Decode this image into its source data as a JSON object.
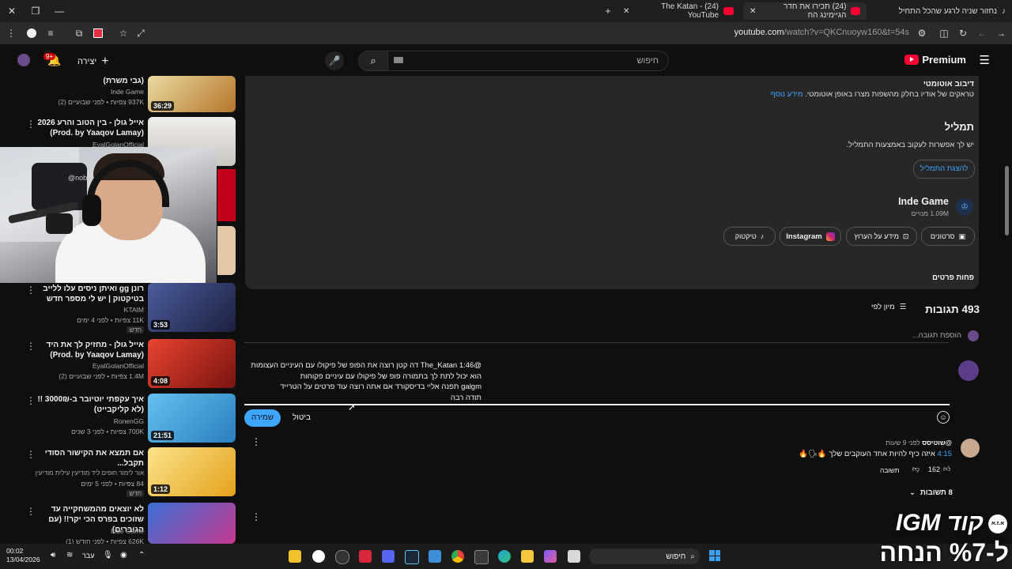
{
  "browser": {
    "tabs": [
      {
        "title": "נחזור שניה לרגע שהכל התחיל",
        "icon": "tiktok-icon",
        "active": false
      },
      {
        "title": "(24) תכירו את חדר הגיימינג הח",
        "icon": "youtube-icon",
        "active": true
      },
      {
        "title": "(24) The Katan - YouTube",
        "icon": "youtube-icon",
        "active": false
      }
    ],
    "url_main": "youtube.com",
    "url_rest": "/watch?v=QKCnuoyw160&t=54s",
    "new_tab": "+"
  },
  "masthead": {
    "search_placeholder": "חיפוש",
    "create_label": "יצירה",
    "notif_count": "9+",
    "premium_label": "Premium"
  },
  "sidebar_videos": [
    {
      "title": "(גבי משרת)",
      "channel": "Inde Game",
      "meta": "937K צפיות • לפני שבועיים (2)",
      "duration": "36:29",
      "thumb_color": "#c79a2e"
    },
    {
      "title": "אייל גולן - בין הטוב והרע 2026 (Prod. by Yaaqov Lamay)",
      "channel": "EyalGolanOfficial",
      "meta": "",
      "duration": "",
      "thumb_color": "#e9e6e1"
    },
    {
      "title": "רונן gg ואיתן ניסים עלו ללייב בטיקטוק | יש לי מספר חדש",
      "channel": "KTAIM",
      "meta": "11K צפיות • לפני 4 ימים",
      "duration": "3:53",
      "badge": "חדש",
      "thumb_color": "#3a3f6e"
    },
    {
      "title": "אייל גולן - מחזיק לך את היד (Prod. by Yaaqov Lamay)",
      "channel": "EyalGolanOfficial",
      "meta": "1.4M צפיות • לפני שבועיים (2)",
      "duration": "4:08",
      "thumb_color": "#d63b2b"
    },
    {
      "title": "איך עקפתי יוטיובר ב-3000₪ !! (לא קליקבייט)",
      "channel": "RonenGG",
      "meta": "700K צפיות • לפני 3 שנים",
      "duration": "21:51",
      "thumb_color": "#3f9fd8"
    },
    {
      "title": "אם תמצא את הקישור הסודי תקבל...",
      "channel": "אור לימור חופים ליד מודיעין עילית מודיעין",
      "meta": "84 צפיות • לפני 5 ימים",
      "duration": "1:12",
      "badge": "חדש",
      "thumb_color": "#f4c64d"
    },
    {
      "title": "לא יוצאים מהמשחקייה עד שזוכים בפרס הכי יקר!! (עם הגוברים)",
      "channel": "Inde Game",
      "meta": "626K צפיות • לפני חודש (1)",
      "duration": "",
      "thumb_color": "#2e5ab8"
    }
  ],
  "webcam": {
    "shirt_text": "@noblechair"
  },
  "description": {
    "dubbing_title": "דיבוב אוטומטי",
    "dubbing_text": "טראקים של אודיו בחלק מהשפות מצרו באופן אוטומטי.",
    "dubbing_link": "מידע נוסף",
    "transcript_title": "תמליל",
    "transcript_text": "יש לך אפשרות לעקוב באמצעות התמליל.",
    "transcript_button": "להצגת התמליל",
    "channel_name": "Inde Game",
    "channel_subs": "1.09M מנויים",
    "links": [
      {
        "label": "סרטונים",
        "icon": "video-icon"
      },
      {
        "label": "מידע על הערוץ",
        "icon": "person-icon"
      },
      {
        "label": "Instagram",
        "icon": "instagram-icon"
      },
      {
        "label": "טיקטוק",
        "icon": "tiktok-icon"
      }
    ],
    "show_less": "פחות פרטים"
  },
  "comments": {
    "count_label": "493 תגובות",
    "sort_label": "מיון לפי",
    "add_placeholder": "הוספת תגובה...",
    "draft_lines": [
      "@The_Katan 1:46  דה קטן רוצה את הפופ של פיקולו עם העיניים העצומות",
      "הוא יכול לתת לך בתמורה פופ של פיקולו עם עיניים פקוחות",
      "galgm תפנה אליי בדיסקורד אם אתה רוצה עוד פרטים על הטרייד",
      "תודה רבה"
    ],
    "save_label": "שמירה",
    "cancel_label": "ביטול",
    "top_comment": {
      "author": "@שוטיסס",
      "time": "לפני 9 שעות",
      "timestamp_link": "4:15",
      "text": "איזה כיף להיות אחד העוקבים שלך",
      "likes": "162",
      "reply_label": "תשובה",
      "replies_label": "8 תשובות"
    }
  },
  "taskbar": {
    "time": "00:02",
    "date": "13/04/2026",
    "lang": "עבר",
    "search_label": "חיפוש"
  },
  "promo": {
    "line1": "קוד IGM",
    "line2": "ל-%7 הנחה",
    "badge": "א.ז.א"
  }
}
